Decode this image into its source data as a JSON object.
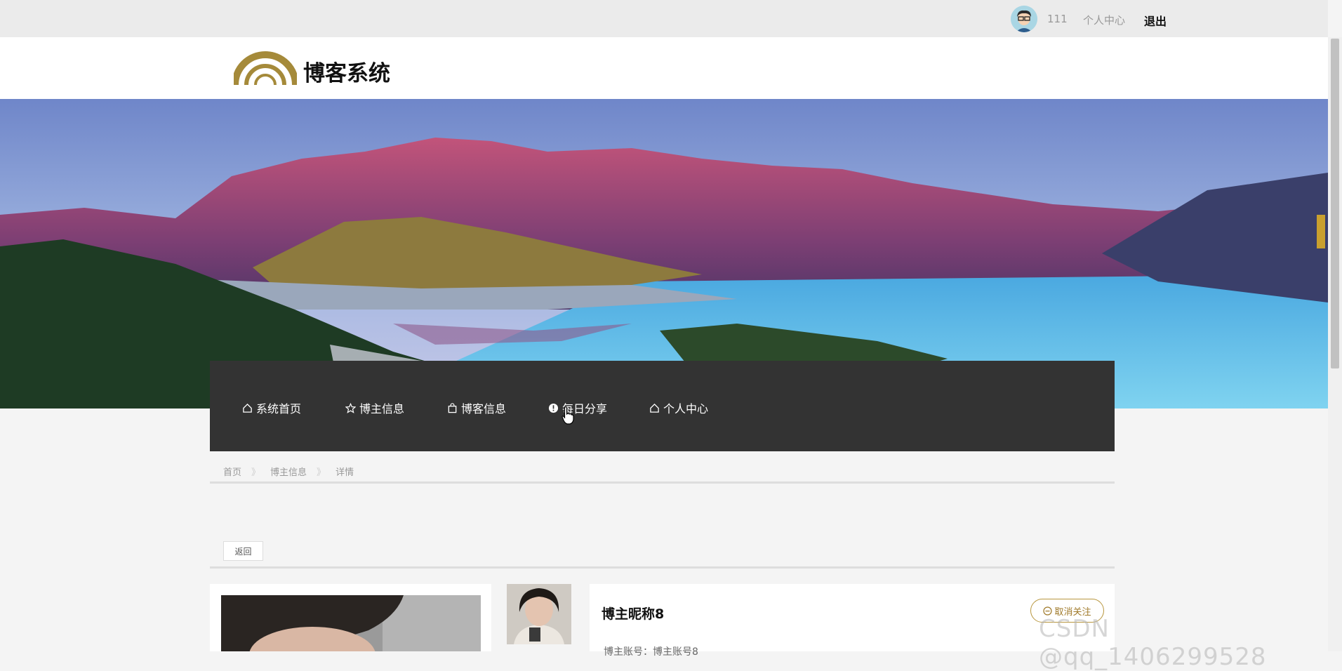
{
  "topbar": {
    "user": "111",
    "center": "个人中心",
    "logout": "退出"
  },
  "header": {
    "title": "博客系统"
  },
  "nav": [
    {
      "label": "系统首页",
      "icon": "home-icon"
    },
    {
      "label": "博主信息",
      "icon": "star-icon"
    },
    {
      "label": "博客信息",
      "icon": "bag-icon"
    },
    {
      "label": "每日分享",
      "icon": "info-icon"
    },
    {
      "label": "个人中心",
      "icon": "home-icon"
    }
  ],
  "breadcrumb": {
    "home": "首页",
    "sep": "》",
    "section": "博主信息",
    "page": "详情"
  },
  "actions": {
    "back": "返回",
    "unfollow": "取消关注"
  },
  "blogger": {
    "nickname": "博主昵称8",
    "account_line": "博主账号：博主账号8"
  },
  "watermark": "CSDN @qq_1406299528"
}
